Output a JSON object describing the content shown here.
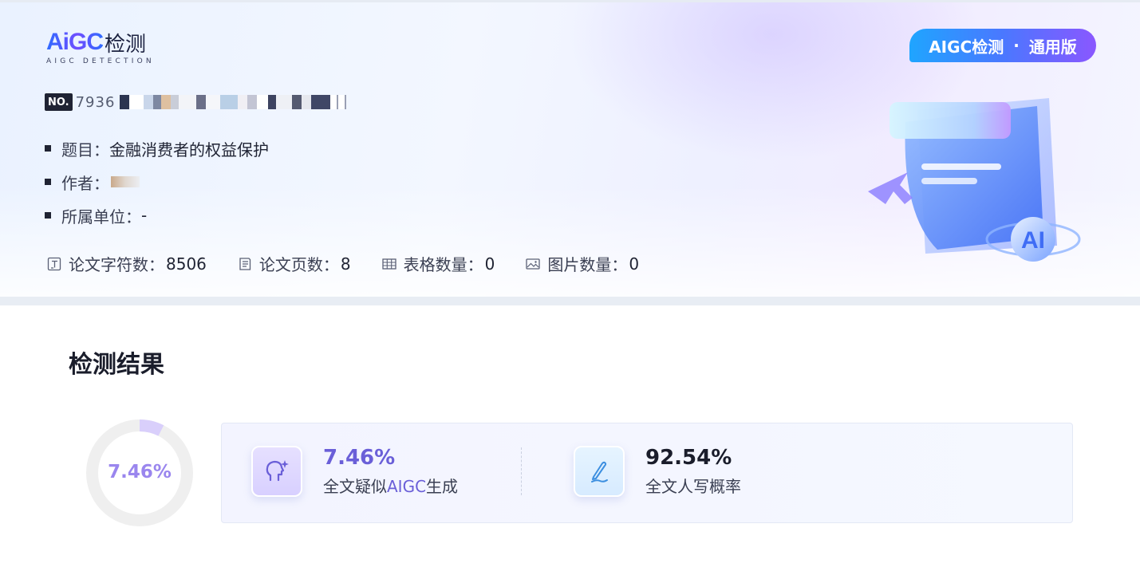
{
  "header": {
    "logo_mark": "AiGC",
    "logo_text": "检测",
    "logo_subtitle": "AIGC DETECTION",
    "version_left": "AIGC检测",
    "version_dot": "·",
    "version_right": "通用版",
    "serial_badge": "NO.",
    "serial_number": "7936"
  },
  "meta": {
    "title_label": "题目：",
    "title_value": "金融消费者的权益保护",
    "author_label": "作者：",
    "author_value": "",
    "unit_label": "所属单位：",
    "unit_value": "-"
  },
  "stats": {
    "chars_label": "论文字符数：",
    "chars_value": "8506",
    "pages_label": "论文页数：",
    "pages_value": "8",
    "tables_label": "表格数量：",
    "tables_value": "0",
    "images_label": "图片数量：",
    "images_value": "0"
  },
  "results": {
    "section_title": "检测结果",
    "donut_value": "7.46%",
    "donut_fraction": 0.0746,
    "aigc_value": "7.46%",
    "aigc_desc_prefix": "全文疑似",
    "aigc_desc_accent": "AIGC",
    "aigc_desc_suffix": "生成",
    "human_value": "92.54%",
    "human_desc": "全文人写概率"
  },
  "colors": {
    "accent": "#6a5fd8",
    "donut_fill": "#d9cffb",
    "donut_track": "#efefef"
  }
}
